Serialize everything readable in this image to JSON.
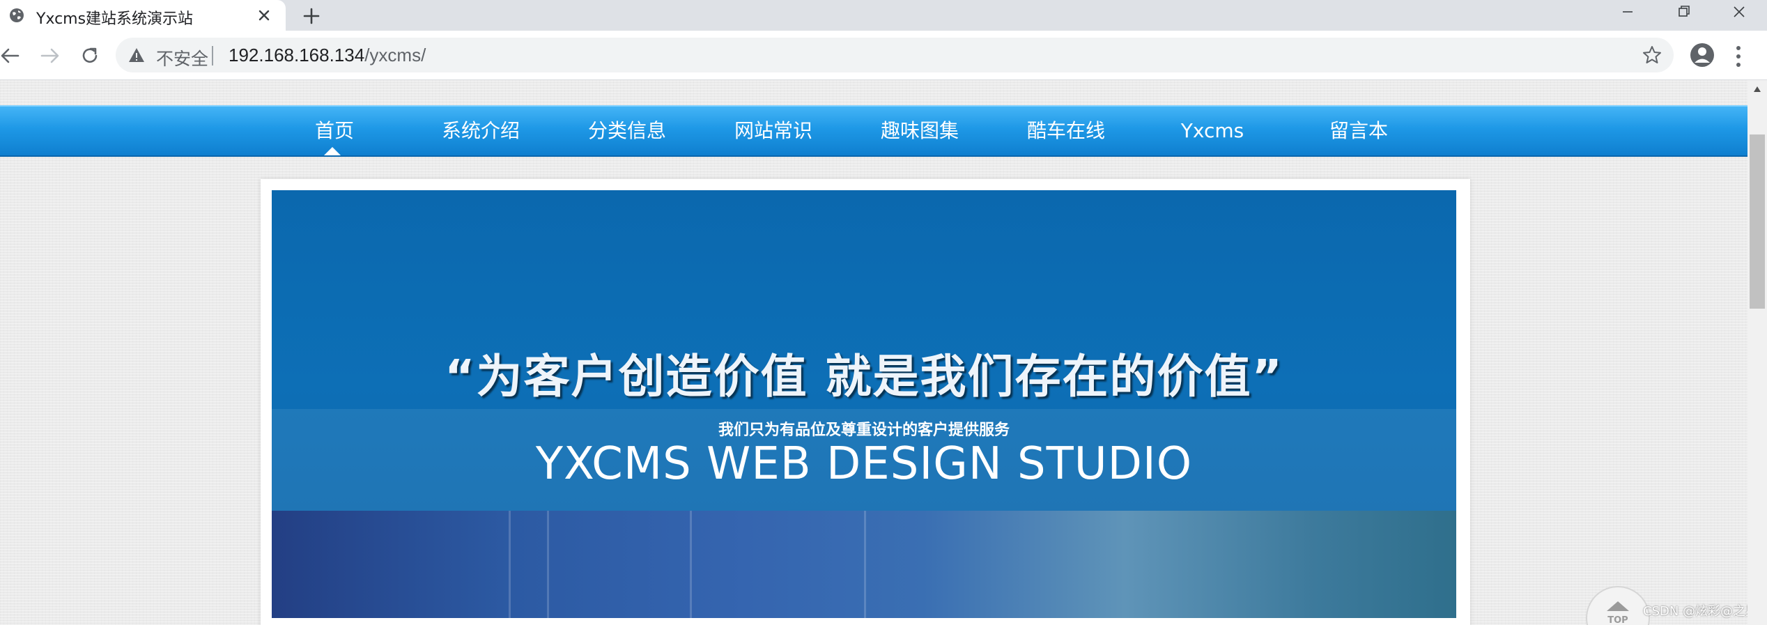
{
  "browser": {
    "tab_title": "Yxcms建站系统演示站",
    "security_label": "不安全",
    "url_host": "192.168.168.134",
    "url_path": "/yxcms/"
  },
  "nav": {
    "items": [
      "首页",
      "系统介绍",
      "分类信息",
      "网站常识",
      "趣味图集",
      "酷车在线",
      "Yxcms",
      "留言本"
    ],
    "active_index": 0
  },
  "banner": {
    "slogan": "“为客户创造价值  就是我们存在的价值”",
    "subline": "我们只为有品位及尊重设计的客户提供服务",
    "studio": "YXCMS WEB DESIGN STUDIO"
  },
  "back_to_top": {
    "label": "TOP"
  },
  "watermark": "CSDN @炫彩@之星",
  "colors": {
    "nav_blue": "#1e98e6",
    "banner_blue": "#0d6db4"
  }
}
